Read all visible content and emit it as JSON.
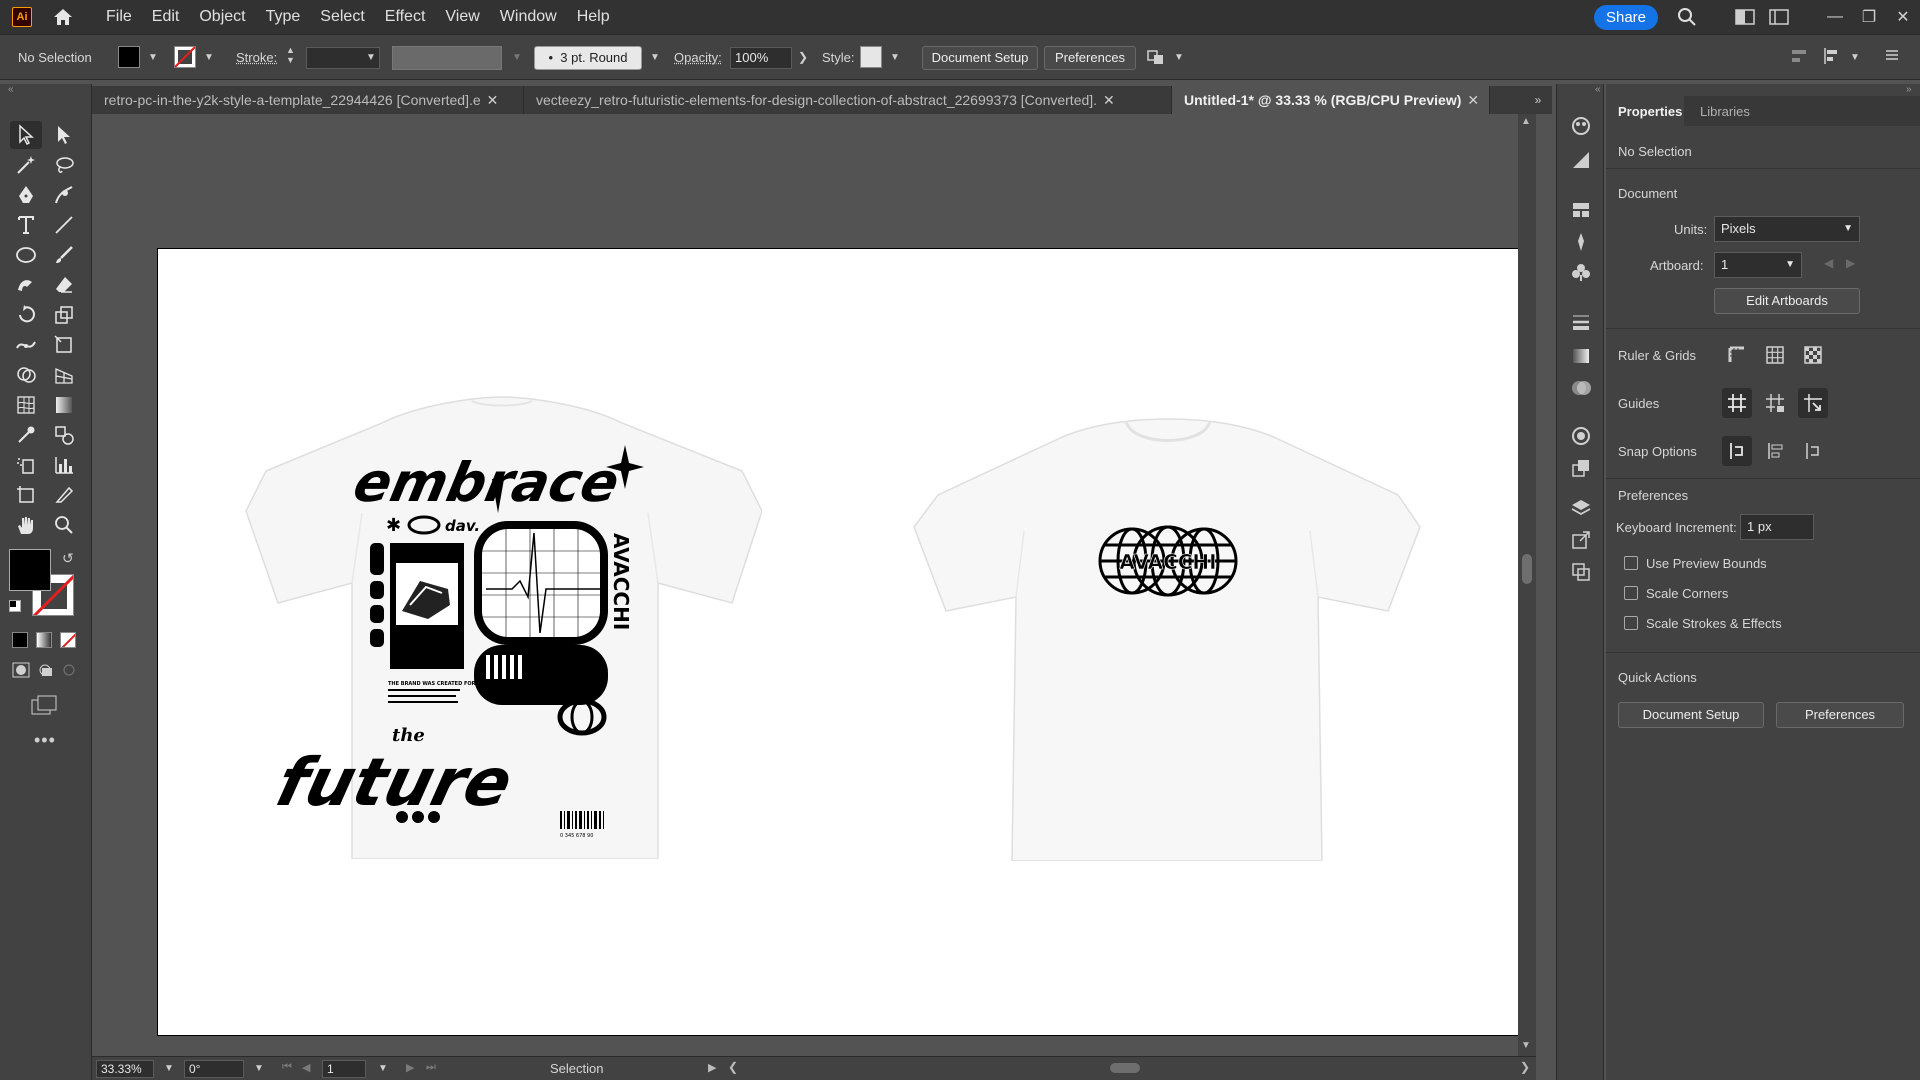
{
  "menubar": {
    "logo": "Ai",
    "items": [
      "File",
      "Edit",
      "Object",
      "Type",
      "Select",
      "Effect",
      "View",
      "Window",
      "Help"
    ],
    "share_label": "Share"
  },
  "controlbar": {
    "selection_status": "No Selection",
    "stroke_label": "Stroke:",
    "brush_label": "3 pt. Round",
    "opacity_label": "Opacity:",
    "opacity_value": "100%",
    "style_label": "Style:",
    "document_setup": "Document Setup",
    "preferences": "Preferences"
  },
  "tabs": [
    {
      "label": "retro-pc-in-the-y2k-style-a-template_22944426 [Converted].e",
      "active": false
    },
    {
      "label": "vecteezy_retro-futuristic-elements-for-design-collection-of-abstract_22699373 [Converted].",
      "active": false
    },
    {
      "label": "Untitled-1* @ 33.33 % (RGB/CPU Preview)",
      "active": true
    }
  ],
  "artwork": {
    "back_print": {
      "headline_top": "embrace",
      "headline_bottom": "future",
      "small_word": "the",
      "side_text": "AVACCHI",
      "mini_text": "dav.",
      "barcode_number": "0 345 678 90",
      "body_copy": "THE BRAND WAS CREATED FOR THOSE WHO DEFINE THE FUTURE"
    },
    "front_print": {
      "logo_text": "AVACCHI"
    }
  },
  "statusbar": {
    "zoom": "33.33%",
    "rotation": "0°",
    "artboard_num": "1",
    "tool_name": "Selection"
  },
  "properties": {
    "tab_properties": "Properties",
    "tab_libraries": "Libraries",
    "selection": "No Selection",
    "document_title": "Document",
    "units_label": "Units:",
    "units_value": "Pixels",
    "artboard_label": "Artboard:",
    "artboard_value": "1",
    "edit_artboards": "Edit Artboards",
    "ruler_grids": "Ruler & Grids",
    "guides": "Guides",
    "snap_options": "Snap Options",
    "preferences_title": "Preferences",
    "keyboard_increment_label": "Keyboard Increment:",
    "keyboard_increment_value": "1 px",
    "checkboxes": [
      "Use Preview Bounds",
      "Scale Corners",
      "Scale Strokes & Effects"
    ],
    "quick_actions": "Quick Actions",
    "qa_document_setup": "Document Setup",
    "qa_preferences": "Preferences"
  },
  "colors": {
    "accent": "#1473e6",
    "app_bg": "#535353",
    "panel_bg": "#424242",
    "menubar_bg": "#323232"
  }
}
